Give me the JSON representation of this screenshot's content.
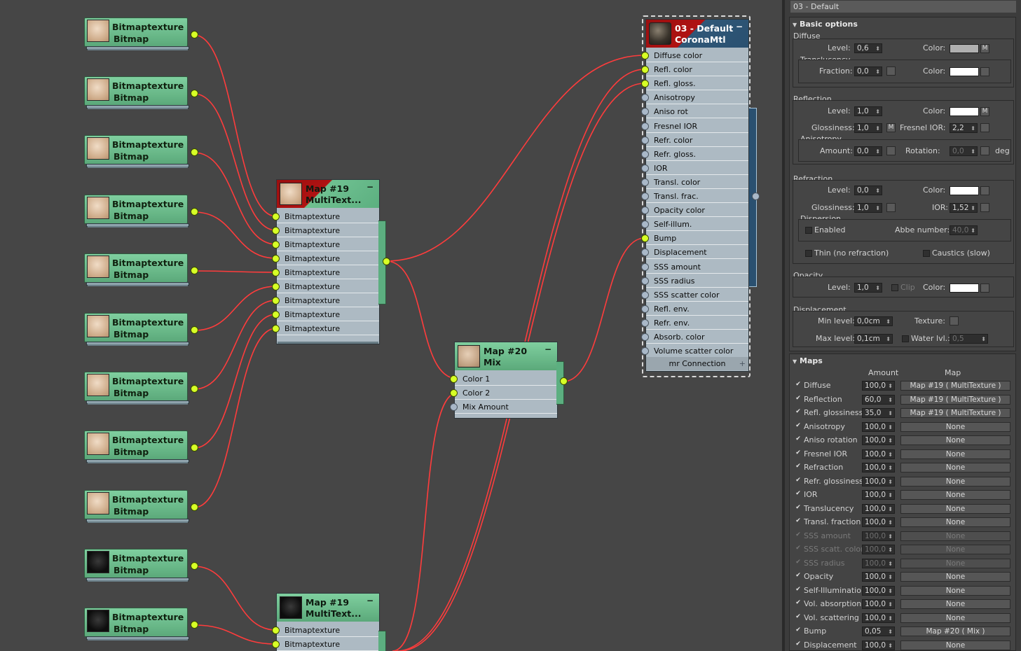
{
  "bitmap_nodes": [
    {
      "title": "Bitmaptexture",
      "subtitle": "Bitmap",
      "thumb": "skin"
    },
    {
      "title": "Bitmaptexture",
      "subtitle": "Bitmap",
      "thumb": "skin"
    },
    {
      "title": "Bitmaptexture",
      "subtitle": "Bitmap",
      "thumb": "skin"
    },
    {
      "title": "Bitmaptexture",
      "subtitle": "Bitmap",
      "thumb": "skin"
    },
    {
      "title": "Bitmaptexture",
      "subtitle": "Bitmap",
      "thumb": "skin"
    },
    {
      "title": "Bitmaptexture",
      "subtitle": "Bitmap",
      "thumb": "skin"
    },
    {
      "title": "Bitmaptexture",
      "subtitle": "Bitmap",
      "thumb": "skin"
    },
    {
      "title": "Bitmaptexture",
      "subtitle": "Bitmap",
      "thumb": "skin"
    },
    {
      "title": "Bitmaptexture",
      "subtitle": "Bitmap",
      "thumb": "skin"
    },
    {
      "title": "Bitmaptexture",
      "subtitle": "Bitmap",
      "thumb": "dark"
    },
    {
      "title": "Bitmaptexture",
      "subtitle": "Bitmap",
      "thumb": "dark"
    }
  ],
  "multi1": {
    "title": "Map #19",
    "subtitle": "MultiText...",
    "minus": "−",
    "inputs": [
      "Bitmaptexture",
      "Bitmaptexture",
      "Bitmaptexture",
      "Bitmaptexture",
      "Bitmaptexture",
      "Bitmaptexture",
      "Bitmaptexture",
      "Bitmaptexture",
      "Bitmaptexture"
    ]
  },
  "multi2": {
    "title": "Map #19",
    "subtitle": "MultiText...",
    "minus": "−",
    "inputs": [
      "Bitmaptexture",
      "Bitmaptexture"
    ]
  },
  "mix": {
    "title": "Map #20",
    "subtitle": "Mix",
    "minus": "−",
    "inputs": [
      "Color 1",
      "Color 2",
      "Mix Amount"
    ]
  },
  "material": {
    "title": "03 - Default",
    "subtitle": "CoronaMtl",
    "minus": "−",
    "footer": "mr Connection",
    "footer_plus": "+",
    "inputs": [
      {
        "label": "Diffuse color",
        "on": true
      },
      {
        "label": "Refl. color",
        "on": true
      },
      {
        "label": "Refl. gloss.",
        "on": true
      },
      {
        "label": "Anisotropy",
        "on": false
      },
      {
        "label": "Aniso rot",
        "on": false
      },
      {
        "label": "Fresnel IOR",
        "on": false
      },
      {
        "label": "Refr. color",
        "on": false
      },
      {
        "label": "Refr. gloss.",
        "on": false
      },
      {
        "label": "IOR",
        "on": false
      },
      {
        "label": "Transl. color",
        "on": false
      },
      {
        "label": "Transl. frac.",
        "on": false
      },
      {
        "label": "Opacity color",
        "on": false
      },
      {
        "label": "Self-illum.",
        "on": false
      },
      {
        "label": "Bump",
        "on": true
      },
      {
        "label": "Displacement",
        "on": false
      },
      {
        "label": "SSS amount",
        "on": false
      },
      {
        "label": "SSS radius",
        "on": false
      },
      {
        "label": "SSS scatter color",
        "on": false
      },
      {
        "label": "Refl. env.",
        "on": false
      },
      {
        "label": "Refr. env.",
        "on": false
      },
      {
        "label": "Absorb. color",
        "on": false
      },
      {
        "label": "Volume scatter color",
        "on": false
      }
    ]
  },
  "panel": {
    "title": "03 - Default",
    "basic": {
      "header": "Basic options",
      "diffuse": "Diffuse",
      "level_label": "Level:",
      "diffuse_level": "0,6",
      "color_label": "Color:",
      "m": "M",
      "translucency": "Translucency",
      "fraction_label": "Fraction:",
      "fraction": "0,0",
      "reflection": "Reflection",
      "refl_level": "1,0",
      "glossiness_label": "Glossiness:",
      "refl_gloss": "1,0",
      "fresnel_label": "Fresnel IOR:",
      "fresnel": "2,2",
      "anisotropy": "Anisotropy",
      "amount_label": "Amount:",
      "aniso_amount": "0,0",
      "rotation_label": "Rotation:",
      "rotation": "0,0",
      "deg": "deg",
      "refraction": "Refraction",
      "refr_level": "0,0",
      "refr_gloss": "1,0",
      "ior_label": "IOR:",
      "ior": "1,52",
      "dispersion": "Dispersion",
      "enabled": "Enabled",
      "abbe_label": "Abbe number:",
      "abbe": "40,0",
      "thin": "Thin (no refraction)",
      "caustics": "Caustics (slow)",
      "opacity": "Opacity",
      "op_level": "1,0",
      "clip": "Clip",
      "displacement": "Displacement",
      "min_label": "Min level:",
      "min": "0,0cm",
      "texture_label": "Texture:",
      "max_label": "Max level:",
      "max": "0,1cm",
      "water_label": "Water lvl.:",
      "water": "0,5"
    },
    "colors": {
      "diffuse": "#b0b0b0",
      "white": "#ffffff"
    },
    "maps": {
      "header": "Maps",
      "amount_col": "Amount",
      "map_col": "Map",
      "rows": [
        {
          "name": "Diffuse",
          "amount": "100,0",
          "map": "Map #19  ( MultiTexture )",
          "enabled": true
        },
        {
          "name": "Reflection",
          "amount": "60,0",
          "map": "Map #19  ( MultiTexture )",
          "enabled": true
        },
        {
          "name": "Refl. glossiness",
          "amount": "35,0",
          "map": "Map #19  ( MultiTexture )",
          "enabled": true
        },
        {
          "name": "Anisotropy",
          "amount": "100,0",
          "map": "None",
          "enabled": true
        },
        {
          "name": "Aniso rotation",
          "amount": "100,0",
          "map": "None",
          "enabled": true
        },
        {
          "name": "Fresnel IOR",
          "amount": "100,0",
          "map": "None",
          "enabled": true
        },
        {
          "name": "Refraction",
          "amount": "100,0",
          "map": "None",
          "enabled": true
        },
        {
          "name": "Refr. glossiness",
          "amount": "100,0",
          "map": "None",
          "enabled": true
        },
        {
          "name": "IOR",
          "amount": "100,0",
          "map": "None",
          "enabled": true
        },
        {
          "name": "Translucency",
          "amount": "100,0",
          "map": "None",
          "enabled": true
        },
        {
          "name": "Transl. fraction",
          "amount": "100,0",
          "map": "None",
          "enabled": true
        },
        {
          "name": "SSS amount",
          "amount": "100,0",
          "map": "None",
          "enabled": false
        },
        {
          "name": "SSS scatt. color",
          "amount": "100,0",
          "map": "None",
          "enabled": false
        },
        {
          "name": "SSS radius",
          "amount": "100,0",
          "map": "None",
          "enabled": false
        },
        {
          "name": "Opacity",
          "amount": "100,0",
          "map": "None",
          "enabled": true
        },
        {
          "name": "Self-Illumination",
          "amount": "100,0",
          "map": "None",
          "enabled": true
        },
        {
          "name": "Vol. absorption",
          "amount": "100,0",
          "map": "None",
          "enabled": true
        },
        {
          "name": "Vol. scattering",
          "amount": "100,0",
          "map": "None",
          "enabled": true
        },
        {
          "name": "Bump",
          "amount": "0,05",
          "map": "Map #20  ( Mix )",
          "enabled": true
        },
        {
          "name": "Displacement",
          "amount": "100,0",
          "map": "None",
          "enabled": true
        }
      ]
    }
  }
}
